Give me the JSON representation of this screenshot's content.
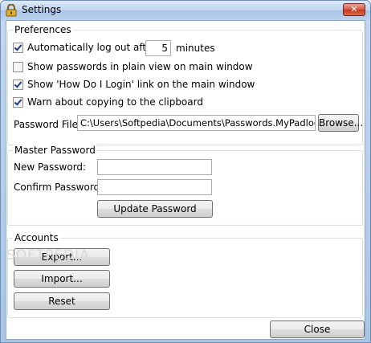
{
  "window": {
    "title": "Settings",
    "close_glyph": "✕"
  },
  "preferences": {
    "legend": "Preferences",
    "auto_logout_label": "Automatically log out after:",
    "auto_logout_value": "5",
    "auto_logout_unit": "minutes",
    "auto_logout_checked": true,
    "show_plain_label": "Show passwords in plain view on main window",
    "show_plain_checked": false,
    "show_howto_label": "Show 'How Do I Login' link on the main window",
    "show_howto_checked": true,
    "warn_clipboard_label": "Warn about copying to the clipboard",
    "warn_clipboard_checked": true,
    "password_file_label": "Password File:",
    "password_file_value": "C:\\Users\\Softpedia\\Documents\\Passwords.MyPadlock",
    "browse_label": "Browse..."
  },
  "master_password": {
    "legend": "Master Password",
    "new_label": "New Password:",
    "new_value": "",
    "confirm_label": "Confirm Password:",
    "confirm_value": "",
    "update_label": "Update Password"
  },
  "accounts": {
    "legend": "Accounts",
    "export_label": "Export...",
    "import_label": "Import...",
    "reset_label": "Reset"
  },
  "watermark": "SOFTPEDIA",
  "footer": {
    "close_label": "Close"
  }
}
